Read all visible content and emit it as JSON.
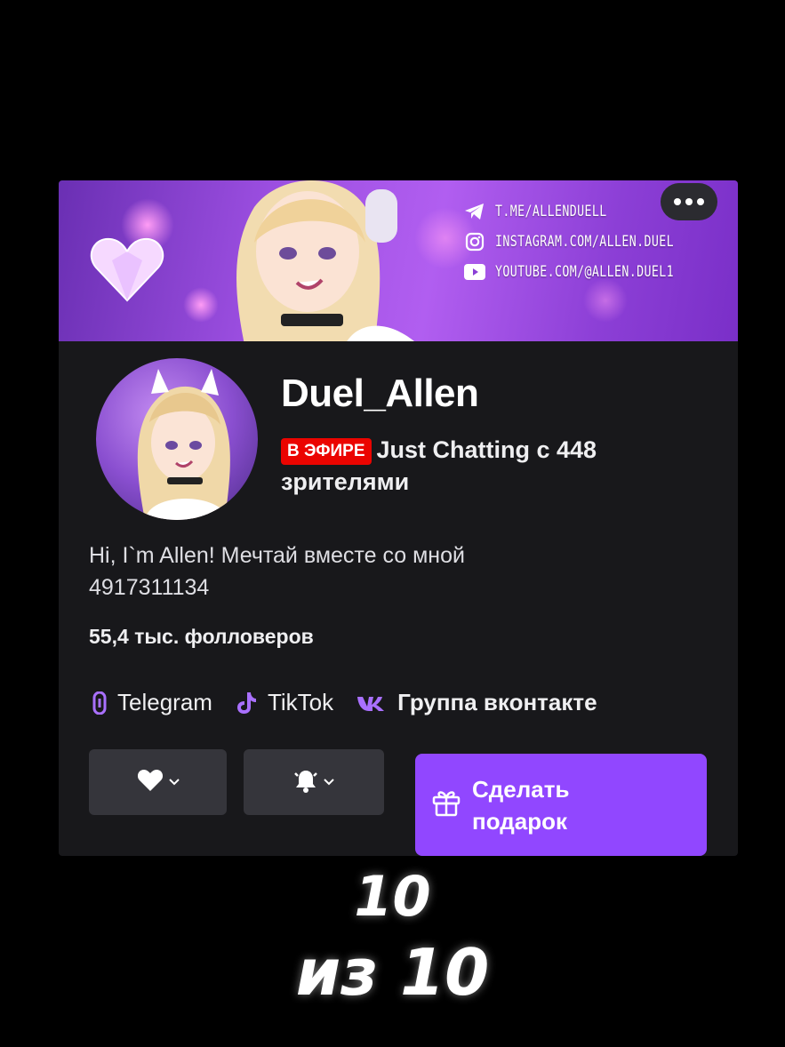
{
  "profile": {
    "banner_links": [
      {
        "icon": "telegram-icon",
        "text": "T.ME/ALLENDUELL"
      },
      {
        "icon": "instagram-icon",
        "text": "INSTAGRAM.COM/ALLEN.DUEL"
      },
      {
        "icon": "youtube-icon",
        "text": "YOUTUBE.COM/@ALLEN.DUEL1"
      }
    ],
    "more_icon": "ellipsis-icon",
    "name": "Duel_Allen",
    "live_badge": "В ЭФИРЕ",
    "live_text": "Just Chatting с 448 зрителями",
    "bio_line1": "Hi, I`m Allen! Мечтай вместе со мной",
    "bio_line2": "4917311134",
    "followers": "55,4 тыс. фолловеров",
    "socials": [
      {
        "icon": "link-icon",
        "label": "Telegram"
      },
      {
        "icon": "tiktok-icon",
        "label": "TikTok"
      },
      {
        "icon": "vk-icon",
        "label": "Группа вконтакте"
      }
    ],
    "follow_icon": "heart-icon",
    "notify_icon": "bell-icon",
    "gift_label": "Сделать подарок",
    "gift_icon": "gift-icon",
    "accent_color": "#9147ff",
    "live_color": "#eb0400"
  },
  "overlay": {
    "line1": "10",
    "line2": "из 10"
  }
}
